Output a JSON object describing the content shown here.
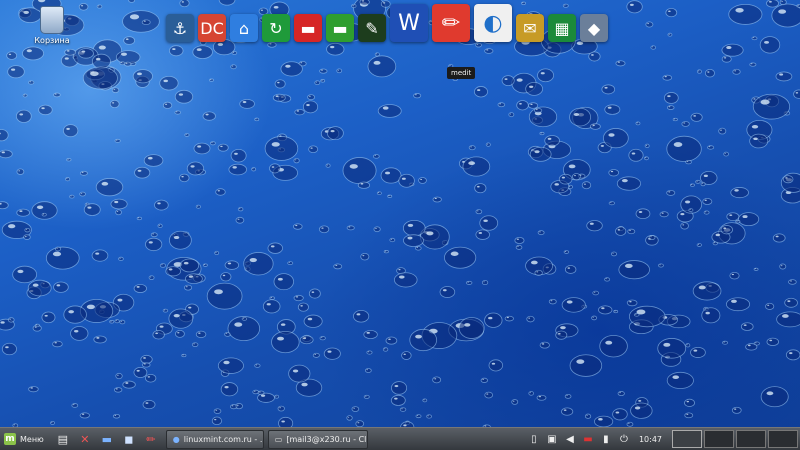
{
  "desktop": {
    "trash_label": "Корзина"
  },
  "dock": {
    "items": [
      {
        "name": "anchor-icon",
        "glyph": "⚓",
        "bg": "#2a5e98"
      },
      {
        "name": "docs-icon",
        "glyph": "DC",
        "bg": "#d64533"
      },
      {
        "name": "home-folder-icon",
        "glyph": "⌂",
        "bg": "#2f7ee0"
      },
      {
        "name": "sync-icon",
        "glyph": "↻",
        "bg": "#1f9a3a"
      },
      {
        "name": "red-folder-icon",
        "glyph": "▬",
        "bg": "#d62626"
      },
      {
        "name": "green-folder-icon",
        "glyph": "▬",
        "bg": "#2f9e2f"
      },
      {
        "name": "book-icon",
        "glyph": "✎",
        "bg": "#1d3d1d"
      },
      {
        "name": "word-icon",
        "glyph": "W",
        "bg": "#1f4fb5"
      },
      {
        "name": "medit-icon",
        "glyph": "✏",
        "bg": "#e03a2e"
      },
      {
        "name": "libreoffice-icon",
        "glyph": "◐",
        "bg": "#f0f0f0"
      },
      {
        "name": "envelope-icon",
        "glyph": "✉",
        "bg": "#c79b26"
      },
      {
        "name": "spreadsheet-icon",
        "glyph": "▦",
        "bg": "#1b8a3a"
      },
      {
        "name": "virtualbox-icon",
        "glyph": "◆",
        "bg": "#6b7f9a"
      }
    ],
    "tooltip": "medit"
  },
  "panel": {
    "menu_label": "Меню",
    "tasks": [
      {
        "label": "linuxmint.com.ru - ..."
      },
      {
        "label": "[mail3@x230.ru - Cl..."
      }
    ],
    "clock": "10:47"
  }
}
